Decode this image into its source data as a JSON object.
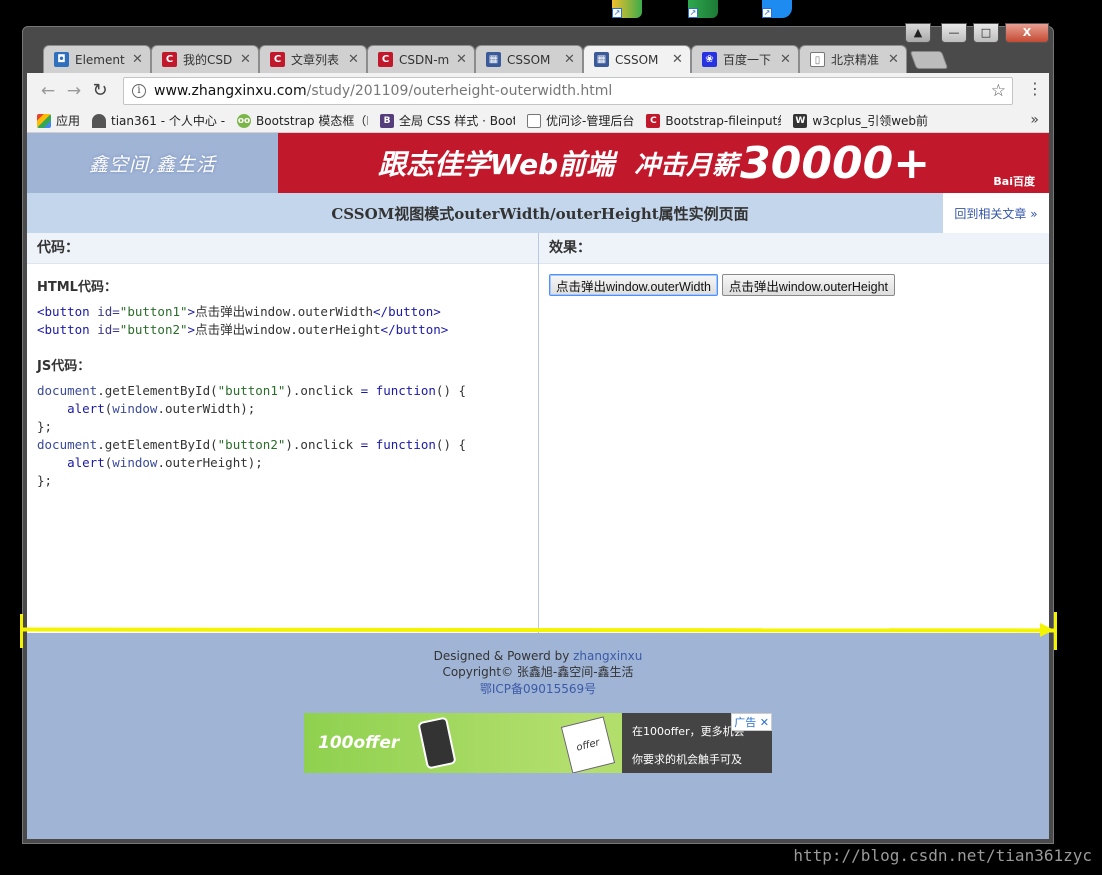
{
  "colors": {
    "brand_red": "#c2182b",
    "banner_blue": "#a0b4d6",
    "title_bar": "#c4d6ec",
    "annotation": "#f4f400",
    "footer_bg": "#a0b4d6"
  },
  "window": {
    "controls": {
      "close": "X",
      "min": "—",
      "max": "□",
      "user": "▲"
    }
  },
  "tabs": [
    {
      "label": "Element",
      "icon": "devtools-icon"
    },
    {
      "label": "我的CSD",
      "icon": "csdn-icon"
    },
    {
      "label": "文章列表",
      "icon": "csdn-icon"
    },
    {
      "label": "CSDN-m",
      "icon": "csdn-icon"
    },
    {
      "label": "CSSOM",
      "icon": "zxx-icon"
    },
    {
      "label": "CSSOM",
      "icon": "zxx-icon"
    },
    {
      "label": "百度一下",
      "icon": "baidu-icon"
    },
    {
      "label": "北京精准",
      "icon": "page-icon"
    }
  ],
  "address": {
    "host": "www.zhangxinxu.com",
    "path": "/study/201109/outerheight-outerwidth.html"
  },
  "bookmarks": [
    {
      "label": "应用"
    },
    {
      "label": "tian361 - 个人中心 -"
    },
    {
      "label": "Bootstrap 模态框（M"
    },
    {
      "label": "全局 CSS 样式 · Boot"
    },
    {
      "label": "优问诊-管理后台"
    },
    {
      "label": "Bootstrap-fileinput组"
    },
    {
      "label": "w3cplus_引领web前"
    }
  ],
  "page": {
    "banner_left": "鑫空间,鑫生活",
    "ad_text1": "跟志佳学Web前端",
    "ad_text2": "冲击月薪",
    "ad_num": "30000+",
    "ad_logo": "Bai百度",
    "title": "CSSOM视图模式outerWidth/outerHeight属性实例页面",
    "back_link": "回到相关文章 »",
    "code_head": "代码：",
    "effect_head": "效果：",
    "html_code_head": "HTML代码：",
    "js_code_head": "JS代码：",
    "button1_label": "点击弹出window.outerWidth",
    "button2_label": "点击弹出window.outerHeight",
    "footer_l1_prefix": "Designed & Powerd by ",
    "footer_l1_link": "zhangxinxu",
    "footer_l2": "Copyright© 张鑫旭-鑫空间-鑫生活",
    "footer_l3": "鄂ICP备09015569号",
    "ad2_brand": "100offer",
    "ad2_t1": "在100offer，更多机会",
    "ad2_t2": "你要求的机会触手可及",
    "ad2_tag": "广告",
    "ad2_paper": "offer"
  },
  "watermark": "http://blog.csdn.net/tian361zyc"
}
